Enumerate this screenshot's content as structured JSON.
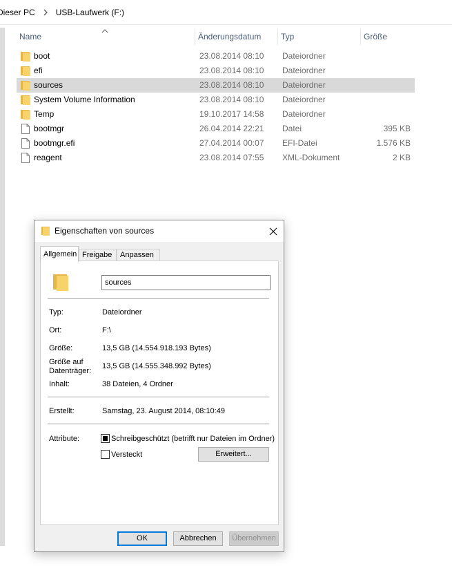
{
  "breadcrumb": {
    "items": [
      "Dieser PC",
      "USB-Laufwerk (F:)"
    ]
  },
  "columns": {
    "name": "Name",
    "modified": "Änderungsdatum",
    "type": "Typ",
    "size": "Größe"
  },
  "files": [
    {
      "name": "boot",
      "modified": "23.08.2014 08:10",
      "type": "Dateiordner",
      "size": "",
      "icon": "folder-icon"
    },
    {
      "name": "efi",
      "modified": "23.08.2014 08:10",
      "type": "Dateiordner",
      "size": "",
      "icon": "folder-icon"
    },
    {
      "name": "sources",
      "modified": "23.08.2014 08:10",
      "type": "Dateiordner",
      "size": "",
      "icon": "folder-icon",
      "selected": true
    },
    {
      "name": "System Volume Information",
      "modified": "23.08.2014 08:10",
      "type": "Dateiordner",
      "size": "",
      "icon": "folder-icon"
    },
    {
      "name": "Temp",
      "modified": "19.10.2017 14:58",
      "type": "Dateiordner",
      "size": "",
      "icon": "folder-icon"
    },
    {
      "name": "bootmgr",
      "modified": "26.04.2014 22:21",
      "type": "Datei",
      "size": "395 KB",
      "icon": "file-icon"
    },
    {
      "name": "bootmgr.efi",
      "modified": "27.04.2014 00:07",
      "type": "EFI-Datei",
      "size": "1.576 KB",
      "icon": "file-icon"
    },
    {
      "name": "reagent",
      "modified": "23.08.2014 07:55",
      "type": "XML-Dokument",
      "size": "2 KB",
      "icon": "file-icon"
    }
  ],
  "dialog": {
    "title": "Eigenschaften von sources",
    "tabs": [
      "Allgemein",
      "Freigabe",
      "Anpassen"
    ],
    "folder_name": "sources",
    "type_label": "Typ:",
    "type_value": "Dateiordner",
    "location_label": "Ort:",
    "location_value": "F:\\",
    "size_label": "Größe:",
    "size_value": "13,5 GB (14.554.918.193 Bytes)",
    "size_on_disk_label_1": "Größe auf",
    "size_on_disk_label_2": "Datenträger:",
    "size_on_disk_value": "13,5 GB (14.555.348.992 Bytes)",
    "contents_label": "Inhalt:",
    "contents_value": "38 Dateien, 4 Ordner",
    "created_label": "Erstellt:",
    "created_value": "Samstag, 23. August 2014, 08:10:49",
    "attributes_label": "Attribute:",
    "readonly_label": "Schreibgeschützt (betrifft nur Dateien im Ordner)",
    "readonly_checked": true,
    "hidden_label": "Versteckt",
    "hidden_checked": false,
    "advanced_button": "Erweitert...",
    "ok_button": "OK",
    "cancel_button": "Abbrechen",
    "apply_button": "Übernehmen"
  },
  "colors": {
    "folder": "#f8d26a",
    "folder_dark": "#e5b545",
    "selection": "#d9d9d9",
    "header_text": "#4c607a",
    "accent": "#0078d7"
  }
}
